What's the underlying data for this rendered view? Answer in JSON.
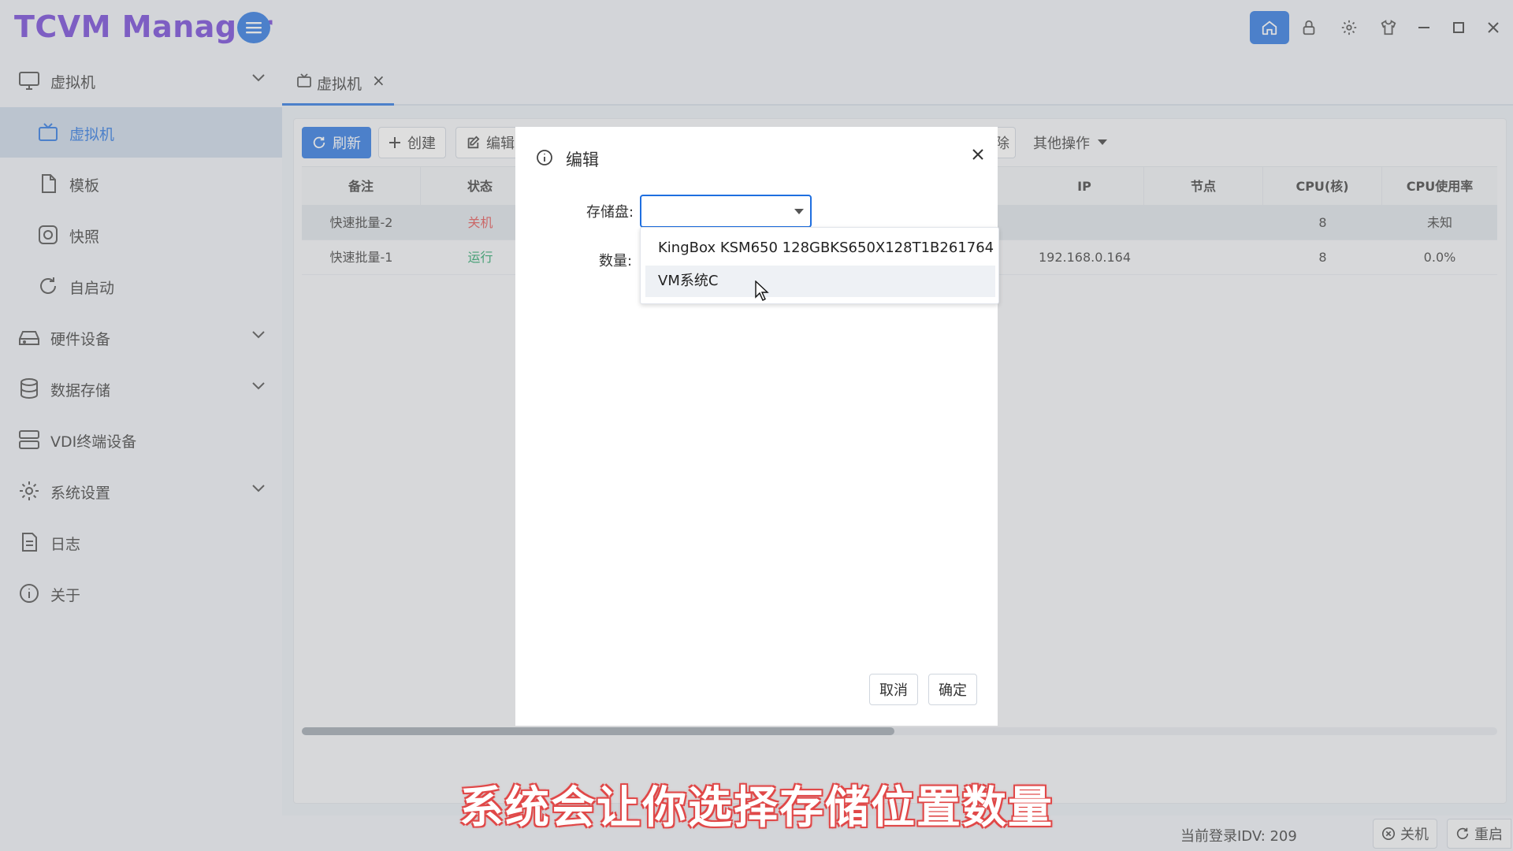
{
  "app": {
    "title": "TCVM Manager"
  },
  "sidebar": {
    "items": [
      {
        "label": "虚拟机",
        "icon": "monitor-icon",
        "expandable": true
      },
      {
        "label": "虚拟机",
        "icon": "tv-icon",
        "active": true
      },
      {
        "label": "模板",
        "icon": "file-icon"
      },
      {
        "label": "快照",
        "icon": "camera-icon"
      },
      {
        "label": "自启动",
        "icon": "refresh-icon"
      },
      {
        "label": "硬件设备",
        "icon": "harddrive-icon",
        "expandable": true
      },
      {
        "label": "数据存储",
        "icon": "database-icon",
        "expandable": true
      },
      {
        "label": "VDI终端设备",
        "icon": "server-icon"
      },
      {
        "label": "系统设置",
        "icon": "gear-icon",
        "expandable": true
      },
      {
        "label": "日志",
        "icon": "document-icon"
      },
      {
        "label": "关于",
        "icon": "info-icon"
      }
    ]
  },
  "tabs": [
    {
      "label": "虚拟机",
      "close": "×"
    }
  ],
  "toolbar": {
    "refresh": "刷新",
    "create": "创建",
    "edit": "编辑",
    "hidden_fragment": "除",
    "other_ops": "其他操作"
  },
  "table": {
    "headers": [
      "备注",
      "状态",
      "IP",
      "节点",
      "CPU(核)",
      "CPU使用率"
    ],
    "rows": [
      {
        "remark": "快速批量-2",
        "status": "关机",
        "ip": "",
        "node": "",
        "cpu": "8",
        "cpu_usage": "未知"
      },
      {
        "remark": "快速批量-1",
        "status": "运行",
        "ip": "192.168.0.164",
        "node": "",
        "cpu": "8",
        "cpu_usage": "0.0%"
      }
    ]
  },
  "statusbar": {
    "login_info": "当前登录IDV: 209",
    "shutdown": "关机",
    "restart": "重启"
  },
  "dialog": {
    "title": "编辑",
    "storage_label": "存储盘:",
    "quantity_label": "数量:",
    "storage_value": "",
    "options": [
      "KingBox KSM650 128GBKS650X128T1B261764",
      "VM系统C"
    ],
    "cancel": "取消",
    "confirm": "确定"
  },
  "subtitle": "系统会让你选择存储位置数量",
  "colors": {
    "accent": "#1f6fe0",
    "brand": "#6a3bd6",
    "stopped": "#e24a4a",
    "running": "#1aa061"
  }
}
